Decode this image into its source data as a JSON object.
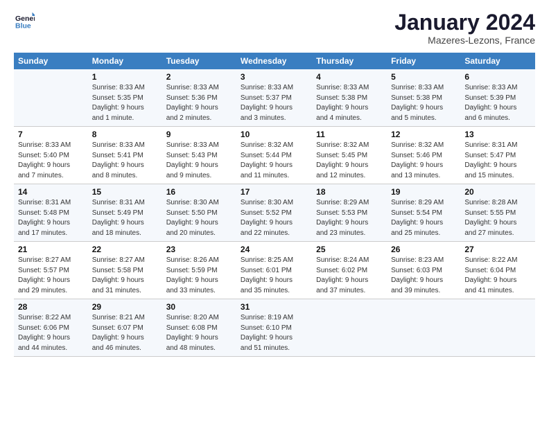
{
  "header": {
    "logo_line1": "General",
    "logo_line2": "Blue",
    "month": "January 2024",
    "location": "Mazeres-Lezons, France"
  },
  "days_of_week": [
    "Sunday",
    "Monday",
    "Tuesday",
    "Wednesday",
    "Thursday",
    "Friday",
    "Saturday"
  ],
  "weeks": [
    [
      {
        "day": "",
        "info": ""
      },
      {
        "day": "1",
        "info": "Sunrise: 8:33 AM\nSunset: 5:35 PM\nDaylight: 9 hours\nand 1 minute."
      },
      {
        "day": "2",
        "info": "Sunrise: 8:33 AM\nSunset: 5:36 PM\nDaylight: 9 hours\nand 2 minutes."
      },
      {
        "day": "3",
        "info": "Sunrise: 8:33 AM\nSunset: 5:37 PM\nDaylight: 9 hours\nand 3 minutes."
      },
      {
        "day": "4",
        "info": "Sunrise: 8:33 AM\nSunset: 5:38 PM\nDaylight: 9 hours\nand 4 minutes."
      },
      {
        "day": "5",
        "info": "Sunrise: 8:33 AM\nSunset: 5:38 PM\nDaylight: 9 hours\nand 5 minutes."
      },
      {
        "day": "6",
        "info": "Sunrise: 8:33 AM\nSunset: 5:39 PM\nDaylight: 9 hours\nand 6 minutes."
      }
    ],
    [
      {
        "day": "7",
        "info": "Sunrise: 8:33 AM\nSunset: 5:40 PM\nDaylight: 9 hours\nand 7 minutes."
      },
      {
        "day": "8",
        "info": "Sunrise: 8:33 AM\nSunset: 5:41 PM\nDaylight: 9 hours\nand 8 minutes."
      },
      {
        "day": "9",
        "info": "Sunrise: 8:33 AM\nSunset: 5:43 PM\nDaylight: 9 hours\nand 9 minutes."
      },
      {
        "day": "10",
        "info": "Sunrise: 8:32 AM\nSunset: 5:44 PM\nDaylight: 9 hours\nand 11 minutes."
      },
      {
        "day": "11",
        "info": "Sunrise: 8:32 AM\nSunset: 5:45 PM\nDaylight: 9 hours\nand 12 minutes."
      },
      {
        "day": "12",
        "info": "Sunrise: 8:32 AM\nSunset: 5:46 PM\nDaylight: 9 hours\nand 13 minutes."
      },
      {
        "day": "13",
        "info": "Sunrise: 8:31 AM\nSunset: 5:47 PM\nDaylight: 9 hours\nand 15 minutes."
      }
    ],
    [
      {
        "day": "14",
        "info": "Sunrise: 8:31 AM\nSunset: 5:48 PM\nDaylight: 9 hours\nand 17 minutes."
      },
      {
        "day": "15",
        "info": "Sunrise: 8:31 AM\nSunset: 5:49 PM\nDaylight: 9 hours\nand 18 minutes."
      },
      {
        "day": "16",
        "info": "Sunrise: 8:30 AM\nSunset: 5:50 PM\nDaylight: 9 hours\nand 20 minutes."
      },
      {
        "day": "17",
        "info": "Sunrise: 8:30 AM\nSunset: 5:52 PM\nDaylight: 9 hours\nand 22 minutes."
      },
      {
        "day": "18",
        "info": "Sunrise: 8:29 AM\nSunset: 5:53 PM\nDaylight: 9 hours\nand 23 minutes."
      },
      {
        "day": "19",
        "info": "Sunrise: 8:29 AM\nSunset: 5:54 PM\nDaylight: 9 hours\nand 25 minutes."
      },
      {
        "day": "20",
        "info": "Sunrise: 8:28 AM\nSunset: 5:55 PM\nDaylight: 9 hours\nand 27 minutes."
      }
    ],
    [
      {
        "day": "21",
        "info": "Sunrise: 8:27 AM\nSunset: 5:57 PM\nDaylight: 9 hours\nand 29 minutes."
      },
      {
        "day": "22",
        "info": "Sunrise: 8:27 AM\nSunset: 5:58 PM\nDaylight: 9 hours\nand 31 minutes."
      },
      {
        "day": "23",
        "info": "Sunrise: 8:26 AM\nSunset: 5:59 PM\nDaylight: 9 hours\nand 33 minutes."
      },
      {
        "day": "24",
        "info": "Sunrise: 8:25 AM\nSunset: 6:01 PM\nDaylight: 9 hours\nand 35 minutes."
      },
      {
        "day": "25",
        "info": "Sunrise: 8:24 AM\nSunset: 6:02 PM\nDaylight: 9 hours\nand 37 minutes."
      },
      {
        "day": "26",
        "info": "Sunrise: 8:23 AM\nSunset: 6:03 PM\nDaylight: 9 hours\nand 39 minutes."
      },
      {
        "day": "27",
        "info": "Sunrise: 8:22 AM\nSunset: 6:04 PM\nDaylight: 9 hours\nand 41 minutes."
      }
    ],
    [
      {
        "day": "28",
        "info": "Sunrise: 8:22 AM\nSunset: 6:06 PM\nDaylight: 9 hours\nand 44 minutes."
      },
      {
        "day": "29",
        "info": "Sunrise: 8:21 AM\nSunset: 6:07 PM\nDaylight: 9 hours\nand 46 minutes."
      },
      {
        "day": "30",
        "info": "Sunrise: 8:20 AM\nSunset: 6:08 PM\nDaylight: 9 hours\nand 48 minutes."
      },
      {
        "day": "31",
        "info": "Sunrise: 8:19 AM\nSunset: 6:10 PM\nDaylight: 9 hours\nand 51 minutes."
      },
      {
        "day": "",
        "info": ""
      },
      {
        "day": "",
        "info": ""
      },
      {
        "day": "",
        "info": ""
      }
    ]
  ]
}
